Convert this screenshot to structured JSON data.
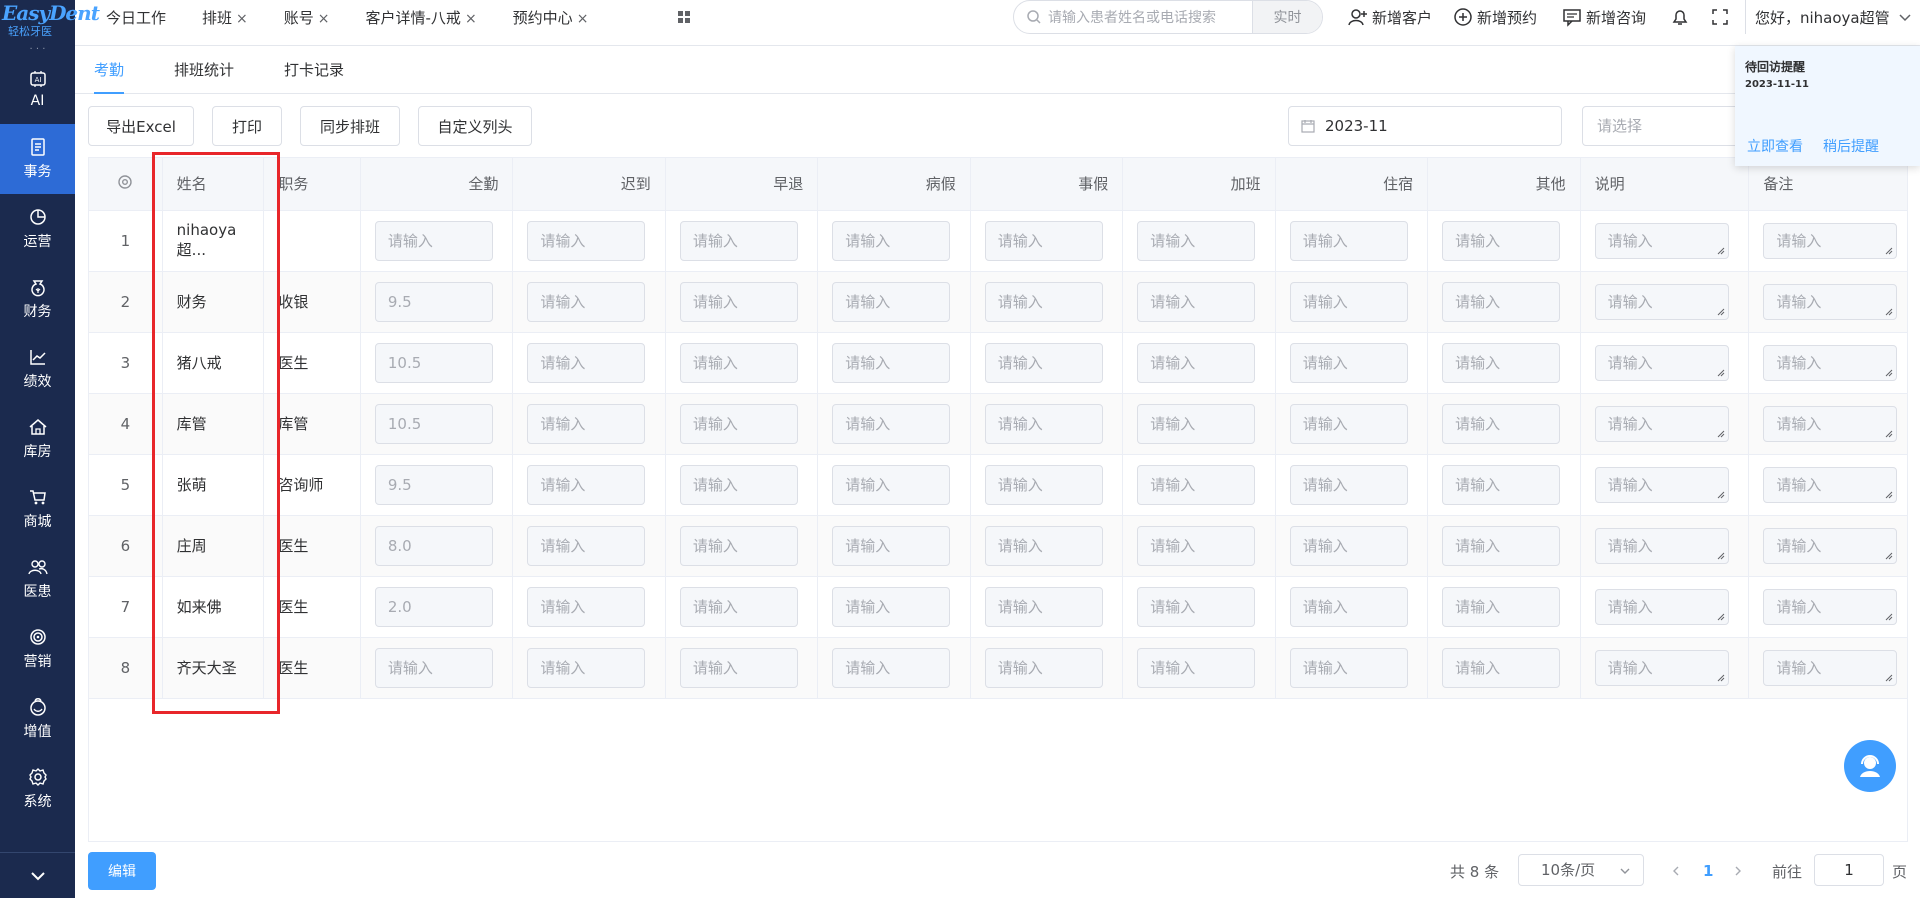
{
  "brand": {
    "logo_text": "EasyDent",
    "logo_sub": "轻松牙医"
  },
  "sidebar": {
    "items": [
      {
        "label": "AI",
        "icon": "ai-icon"
      },
      {
        "label": "事务",
        "icon": "document-icon",
        "active": true
      },
      {
        "label": "运营",
        "icon": "pie-chart-icon"
      },
      {
        "label": "财务",
        "icon": "money-bag-icon"
      },
      {
        "label": "绩效",
        "icon": "trend-chart-icon"
      },
      {
        "label": "库房",
        "icon": "house-icon"
      },
      {
        "label": "商城",
        "icon": "cart-icon"
      },
      {
        "label": "医患",
        "icon": "people-icon"
      },
      {
        "label": "营销",
        "icon": "target-icon"
      },
      {
        "label": "增值",
        "icon": "gift-icon"
      },
      {
        "label": "系统",
        "icon": "gear-icon"
      }
    ],
    "active_color": "#2d6bd6",
    "bg_color": "#1b2a4e"
  },
  "topbar": {
    "tabs": [
      {
        "label": "今日工作",
        "closable": false
      },
      {
        "label": "排班",
        "closable": true
      },
      {
        "label": "账号",
        "closable": true
      },
      {
        "label": "客户详情-八戒",
        "closable": true
      },
      {
        "label": "预约中心",
        "closable": true
      }
    ],
    "close_glyph": "×",
    "search": {
      "placeholder": "请输入患者姓名或电话搜索",
      "mode": "实时"
    },
    "actions": {
      "new_customer": "新增客户",
      "new_appointment": "新增预约",
      "new_consult": "新增咨询"
    },
    "greeting": "您好，nihaoya超管"
  },
  "subtabs": [
    {
      "label": "考勤",
      "active": true
    },
    {
      "label": "排班统计",
      "active": false
    },
    {
      "label": "打卡记录",
      "active": false
    }
  ],
  "toolbar": {
    "export": "导出Excel",
    "print": "打印",
    "sync": "同步排班",
    "custom_cols": "自定义列头",
    "month": "2023-11",
    "select_placeholder": "请选择"
  },
  "table": {
    "headers": [
      "姓名",
      "职务",
      "全勤",
      "迟到",
      "早退",
      "病假",
      "事假",
      "加班",
      "住宿",
      "其他",
      "说明",
      "备注"
    ],
    "input_placeholder": "请输入",
    "rows": [
      {
        "idx": "1",
        "name": "nihaoya超...",
        "role": "",
        "full": ""
      },
      {
        "idx": "2",
        "name": "财务",
        "role": "收银",
        "full": "9.5"
      },
      {
        "idx": "3",
        "name": "猪八戒",
        "role": "医生",
        "full": "10.5"
      },
      {
        "idx": "4",
        "name": "库管",
        "role": "库管",
        "full": "10.5"
      },
      {
        "idx": "5",
        "name": "张萌",
        "role": "咨询师",
        "full": "9.5"
      },
      {
        "idx": "6",
        "name": "庄周",
        "role": "医生",
        "full": "8.0"
      },
      {
        "idx": "7",
        "name": "如来佛",
        "role": "医生",
        "full": "2.0"
      },
      {
        "idx": "8",
        "name": "齐天大圣",
        "role": "医生",
        "full": ""
      }
    ]
  },
  "popup": {
    "title": "待回访提醒",
    "date": "2023-11-11",
    "view": "立即查看",
    "later": "稍后提醒"
  },
  "footer": {
    "edit": "编辑",
    "total": "共 8 条",
    "page_size": "10条/页",
    "current_page": "1",
    "goto": "前往",
    "goto_value": "1",
    "page_unit": "页"
  },
  "highlight_color": "#e8262a"
}
